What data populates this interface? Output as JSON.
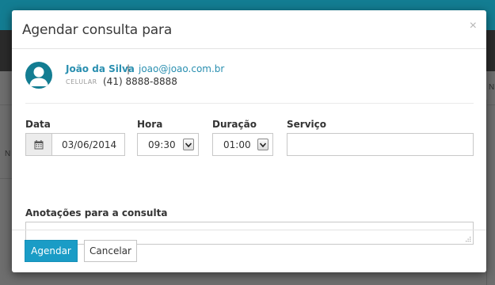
{
  "background": {
    "right_fragment": "N",
    "left_fragment": "N"
  },
  "modal": {
    "title": "Agendar consulta para",
    "close_symbol": "×",
    "patient": {
      "name": "João da Silva",
      "separator": "|",
      "email": "joao@joao.com.br",
      "phone_label": "CELULAR",
      "phone": "(41) 8888-8888"
    },
    "form": {
      "date_label": "Data",
      "date_value": "03/06/2014",
      "time_label": "Hora",
      "time_value": "09:30",
      "duration_label": "Duração",
      "duration_value": "01:00",
      "service_label": "Serviço",
      "service_value": "",
      "notes_label": "Anotações para a consulta",
      "notes_value": ""
    },
    "footer": {
      "submit_label": "Agendar",
      "cancel_label": "Cancelar"
    }
  },
  "colors": {
    "accent": "#1a9cc6",
    "link": "#2a8fb0",
    "top_bar": "#137d92"
  },
  "icons": {
    "calendar": "calendar-icon",
    "avatar": "user-avatar-icon",
    "dropdown": "chevron-down-icon",
    "close": "close-icon"
  }
}
